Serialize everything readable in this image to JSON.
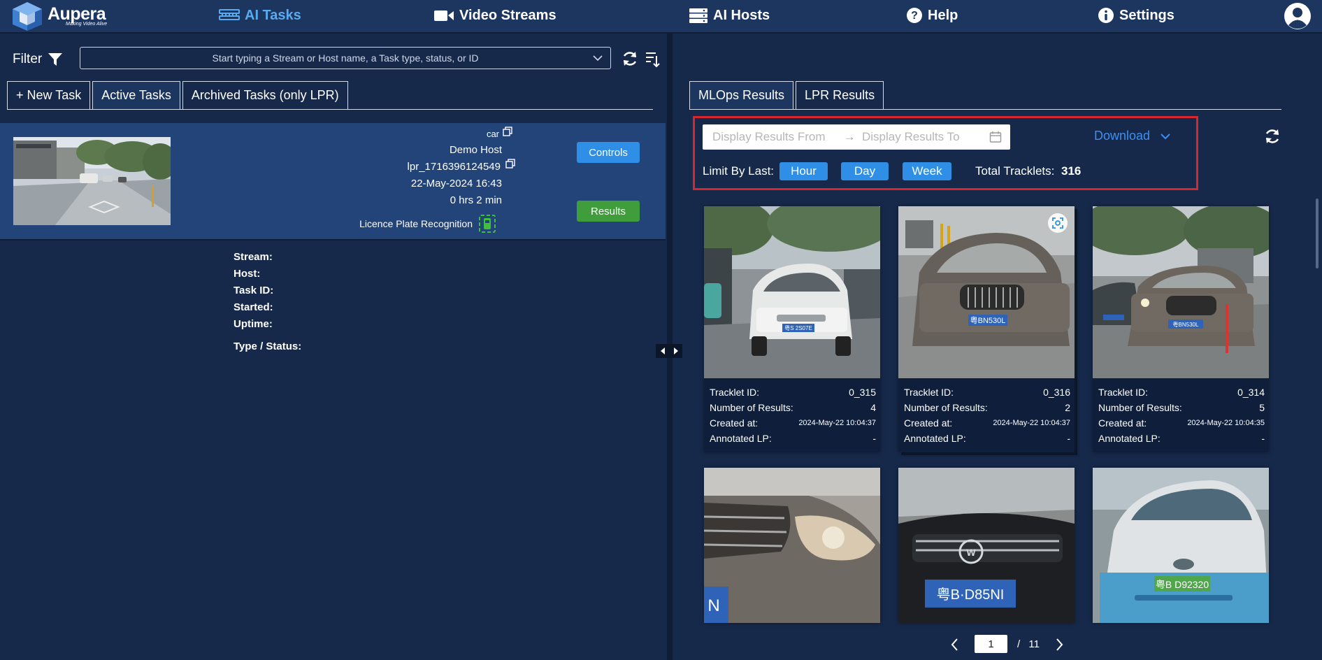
{
  "nav": {
    "brand": "Aupera",
    "tagline": "Making Video Alive",
    "items": [
      {
        "label": "AI Tasks",
        "icon": "server-rack-icon",
        "active": true
      },
      {
        "label": "Video Streams",
        "icon": "video-camera-icon"
      },
      {
        "label": "AI Hosts",
        "icon": "server-stack-icon"
      },
      {
        "label": "Help",
        "icon": "question-circle-icon"
      },
      {
        "label": "Settings",
        "icon": "info-circle-icon"
      }
    ],
    "avatar_icon": "user-avatar-icon"
  },
  "left": {
    "filter_label": "Filter",
    "filter_placeholder": "Start typing a Stream or Host name, a Task type, status, or ID",
    "tabs": [
      "+ New Task",
      "Active Tasks",
      "Archived Tasks (only LPR)"
    ],
    "active_tab": "Active Tasks",
    "task": {
      "labels": {
        "stream": "Stream:",
        "host": "Host:",
        "task_id": "Task ID:",
        "started": "Started:",
        "uptime": "Uptime:",
        "type_status": "Type / Status:"
      },
      "stream": "car",
      "host": "Demo Host",
      "task_id": "lpr_1716396124549",
      "started": "22-May-2024 16:43",
      "uptime": "0 hrs 2 min",
      "type": "Licence Plate Recognition",
      "controls_label": "Controls",
      "results_label": "Results"
    }
  },
  "right": {
    "tabs": [
      "MLOps Results",
      "LPR Results"
    ],
    "active_tab": "MLOps Results",
    "range_from_placeholder": "Display Results From",
    "range_to_placeholder": "Display Results To",
    "range_arrow": "→",
    "download_label": "Download",
    "limit_label": "Limit By Last:",
    "limits": [
      "Hour",
      "Day",
      "Week"
    ],
    "total_label": "Total Tracklets:",
    "total_value": "316",
    "card_labels": {
      "tracklet_id": "Tracklet ID:",
      "num_results": "Number of Results:",
      "created_at": "Created at:",
      "annotated_lp": "Annotated LP:"
    },
    "cards": [
      {
        "tracklet_id": "0_315",
        "num_results": "4",
        "created_at": "2024-May-22 10:04:37",
        "annotated_lp": "-"
      },
      {
        "tracklet_id": "0_316",
        "num_results": "2",
        "created_at": "2024-May-22 10:04:37",
        "annotated_lp": "-"
      },
      {
        "tracklet_id": "0_314",
        "num_results": "5",
        "created_at": "2024-May-22 10:04:35",
        "annotated_lp": "-"
      }
    ],
    "plates": {
      "car_1": "粤S 2S07E",
      "car_2": "粤BN530L",
      "car_3": "粤BN530L",
      "crop_1": "N",
      "crop_2": "粤B·D85NI",
      "crop_3": "粤B D92320"
    },
    "pagination": {
      "current": "1",
      "separator": "/",
      "total": "11"
    }
  },
  "colors": {
    "background": "#17294a",
    "nav_bg": "#1d3660",
    "accent": "#5aaaf0",
    "button_blue": "#2f8fe6",
    "button_green": "#3f9d3c",
    "highlight_border": "#d8262f",
    "status_green": "#3fbf3a"
  }
}
